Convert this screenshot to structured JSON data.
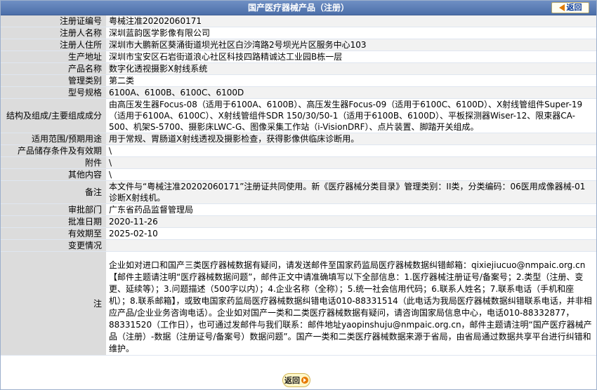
{
  "header": {
    "title": "国产医疗器械产品（注册）",
    "back_label": "返回"
  },
  "rows": [
    {
      "label": "注册证编号",
      "value": "粤械注准20202060171"
    },
    {
      "label": "注册人名称",
      "value": "深圳蓝韵医学影像有限公司"
    },
    {
      "label": "注册人住所",
      "value": "深圳市大鹏新区葵涌街道坝光社区白沙湾路2号坝光片区服务中心103"
    },
    {
      "label": "生产地址",
      "value": "深圳市宝安区石岩街道浪心社区科技四路精诚达工业园B栋一层"
    },
    {
      "label": "产品名称",
      "value": "数字化透视摄影X射线系统"
    },
    {
      "label": "管理类别",
      "value": "第二类"
    },
    {
      "label": "型号规格",
      "value": "6100A、6100B、6100C、6100D"
    },
    {
      "label": "结构及组成/主要组成成分",
      "value": "由高压发生器Focus-08（适用于6100A、6100B）、高压发生器Focus-09（适用于6100C、6100D）、X射线管组件Super-19（适用于6100A、6100C）、X射线管组件SDR 150/30/50-1（适用于6100B、6100D）、平板探测器Wiser-12、限束器CA-500、机架S-5700、摄影床LWC-G、图像采集工作站（i-VisionDRF）、点片装置、脚踏开关组成。"
    },
    {
      "label": "适用范围/预期用途",
      "value": "用于常规、胃肠道X射线透视及摄影检查，获得影像供临床诊断用。"
    },
    {
      "label": "产品储存条件及有效期",
      "value": "\\"
    },
    {
      "label": "附件",
      "value": "\\"
    },
    {
      "label": "其他内容",
      "value": "\\"
    },
    {
      "label": "备注",
      "value": "本文件与“粤械注准20202060171”注册证共同使用。新《医疗器械分类目录》管理类别：II类，分类编码：06医用成像器械-01诊断X射线机。"
    },
    {
      "label": "审批部门",
      "value": "广东省药品监督管理局"
    },
    {
      "label": "批准日期",
      "value": "2020-11-26"
    },
    {
      "label": "有效期至",
      "value": "2025-02-10"
    },
    {
      "label": "变更情况",
      "value": ""
    },
    {
      "label": "注",
      "value": "企业如对进口和国产三类医疗器械数据有疑问，请发送邮件至国家药监局医疗器械数据纠错邮箱：qixiejiucuo@nmpaic.org.cn【邮件主题请注明“医疗器械数据问题”，邮件正文中请准确填写以下全部信息：1.医疗器械注册证号/备案号；2.类型（注册、变更、延续等）；3.问题描述（500字以内）；4.企业名称（全称）；5.统一社会信用代码；6.联系人姓名；7.联系电话（手机和座机）；8.联系邮箱】，或致电国家药监局医疗器械数据纠错电话010-88331514（此电话为我局医疗器械数据纠错联系电话，并非相应产品/企业业务咨询电话）。企业如对国产一类和二类医疗器械数据有疑问，请咨询国家局信息中心，电话010-88332877，88331520（工作日），也可通过发邮件与我们联系：邮件地址yaopinshuju@nmpaic.org.cn，邮件主题请注明“国产医疗器械产品（注册）-数据（注册证号/备案号）数据问题”。国产一类和二类医疗器械数据来源于省局，由省局通过数据共享平台进行纠错和维护。"
    }
  ],
  "footer": {
    "back_label": "返回"
  }
}
